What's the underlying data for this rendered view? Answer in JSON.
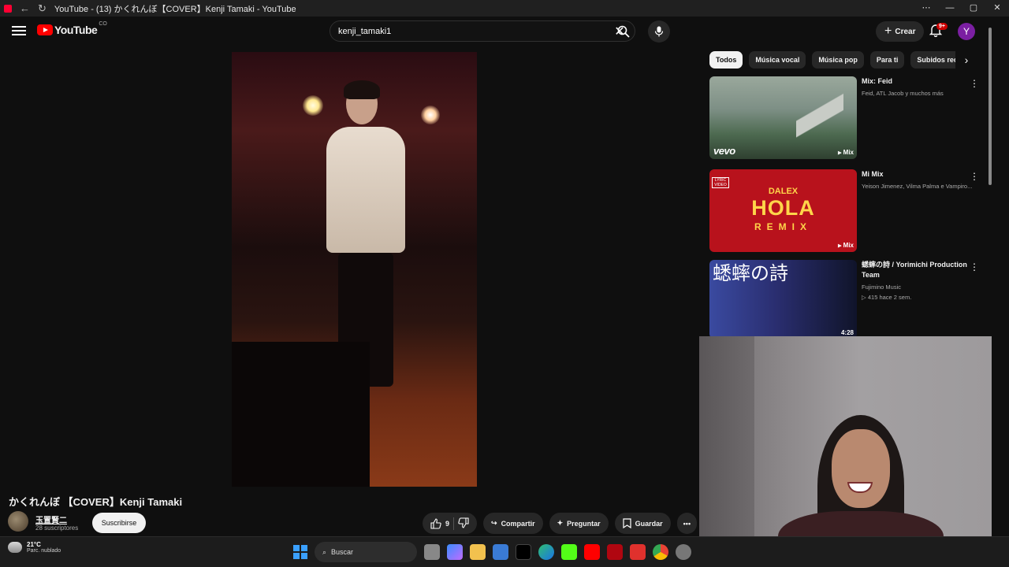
{
  "browser": {
    "window_title": "YouTube - (13) かくれんぼ【COVER】Kenji Tamaki - YouTube",
    "controls": [
      "—",
      "▢",
      "✕"
    ],
    "more": "⋯"
  },
  "masthead": {
    "logo_text": "YouTube",
    "country_code": "CO",
    "search_query": "kenji_tamaki1",
    "create_label": "Crear",
    "notification_count": "9+",
    "avatar_letter": "Y"
  },
  "video": {
    "title": "かくれんぼ 【COVER】Kenji Tamaki",
    "channel_name": "玉置賢二",
    "subscribers": "28 suscriptores",
    "subscribe_label": "Suscribirse",
    "like_count": "9",
    "share_label": "Compartir",
    "ask_label": "Preguntar",
    "save_label": "Guardar"
  },
  "chips": [
    "Todos",
    "Música vocal",
    "Música pop",
    "Para ti",
    "Subidos recien"
  ],
  "recommendations": [
    {
      "title": "Mix: Feid",
      "subtitle": "Feid, ATL Jacob y muchos más",
      "badge": "Mix",
      "thumb_text": "vevo"
    },
    {
      "title": "Mi Mix",
      "subtitle": "Yeison Jimenez, Vilma Palma e Vampiro...",
      "badge": "Mix",
      "thumb_lines": [
        "LYRIC VIDEO",
        "DALEX",
        "HOLA",
        "REMIX"
      ]
    },
    {
      "title": "蟋蟀の詩 / Yorimichi Production Team",
      "subtitle": "Fujimino Music",
      "stats": "415  hace 2 sem.",
      "duration": "4:28",
      "thumb_text": "蟋蟀の詩"
    }
  ],
  "taskbar": {
    "temperature": "21°C",
    "weather": "Parc. nublado",
    "search_label": "Buscar"
  }
}
